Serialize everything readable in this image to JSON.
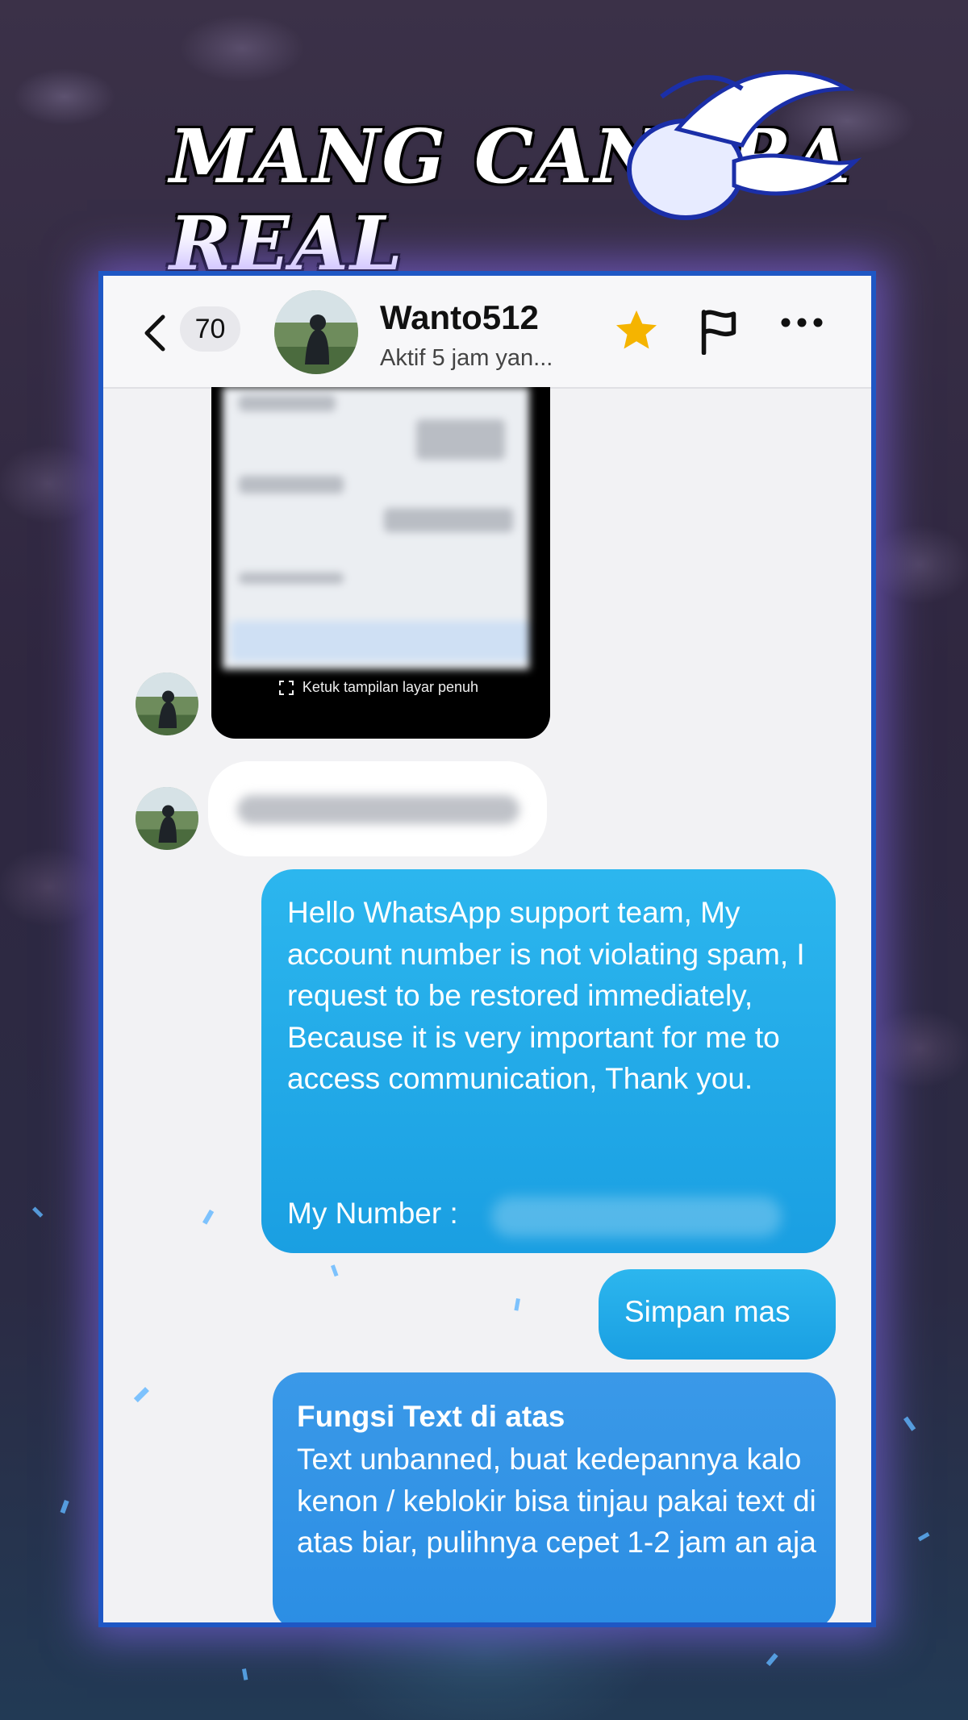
{
  "watermark": {
    "text": "MANG CANDRA REAL"
  },
  "header": {
    "unread_count": "70",
    "contact_name": "Wanto512",
    "status": "Aktif 5 jam yan..."
  },
  "messages": {
    "image_caption": "Ketuk tampilan layar penuh",
    "outgoing_1": "Hello WhatsApp support team, My account number is not violating spam, I request to be restored immediately, Because it is very important for me to access communication, Thank you.",
    "outgoing_1_number_label": "My Number :",
    "outgoing_2": "Simpan mas",
    "outgoing_3_title": "Fungsi Text di atas",
    "outgoing_3_body": "Text unbanned, buat kedepannya kalo kenon / keblokir bisa tinjau pakai text di atas biar, pulihnya cepet 1-2 jam an aja"
  },
  "colors": {
    "accent": "#1f57c4",
    "bubble": "#1a9fe2",
    "star": "#f5b400"
  }
}
